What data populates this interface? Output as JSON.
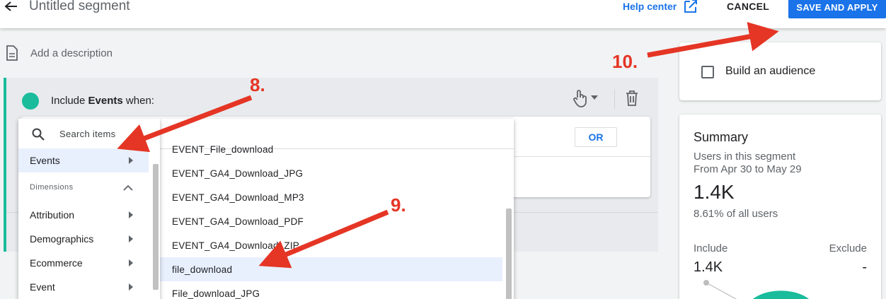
{
  "header": {
    "title": "Untitled segment",
    "help_label": "Help center",
    "cancel_label": "CANCEL",
    "save_label": "SAVE AND APPLY"
  },
  "description": {
    "placeholder": "Add a description"
  },
  "condition": {
    "prefix": "Include",
    "scope": "Events",
    "suffix": "when:",
    "or_label": "OR"
  },
  "category_menu": {
    "search_placeholder": "Search items",
    "selected_label": "Events",
    "section_label": "Dimensions",
    "items": [
      "Attribution",
      "Demographics",
      "Ecommerce",
      "Event"
    ]
  },
  "item_list": {
    "items": [
      "EVENT_File_download",
      "EVENT_GA4_Download_JPG",
      "EVENT_GA4_Download_MP3",
      "EVENT_GA4_Download_PDF",
      "EVENT_GA4_Download_ZIP",
      "file_download",
      "File_download_JPG"
    ],
    "selected_index": 5
  },
  "audience": {
    "label": "Build an audience",
    "checked": false
  },
  "summary": {
    "title": "Summary",
    "subtitle": "Users in this segment",
    "date_range": "From Apr 30 to May 29",
    "value": "1.4K",
    "percent": "8.61% of all users",
    "include_label": "Include",
    "include_value": "1.4K",
    "exclude_label": "Exclude",
    "exclude_value": "-"
  },
  "annotations": {
    "step8": "8.",
    "step9": "9.",
    "step10": "10."
  },
  "colors": {
    "accent": "#1a73e8",
    "teal": "#1abc9c",
    "annotation": "#e53525"
  }
}
